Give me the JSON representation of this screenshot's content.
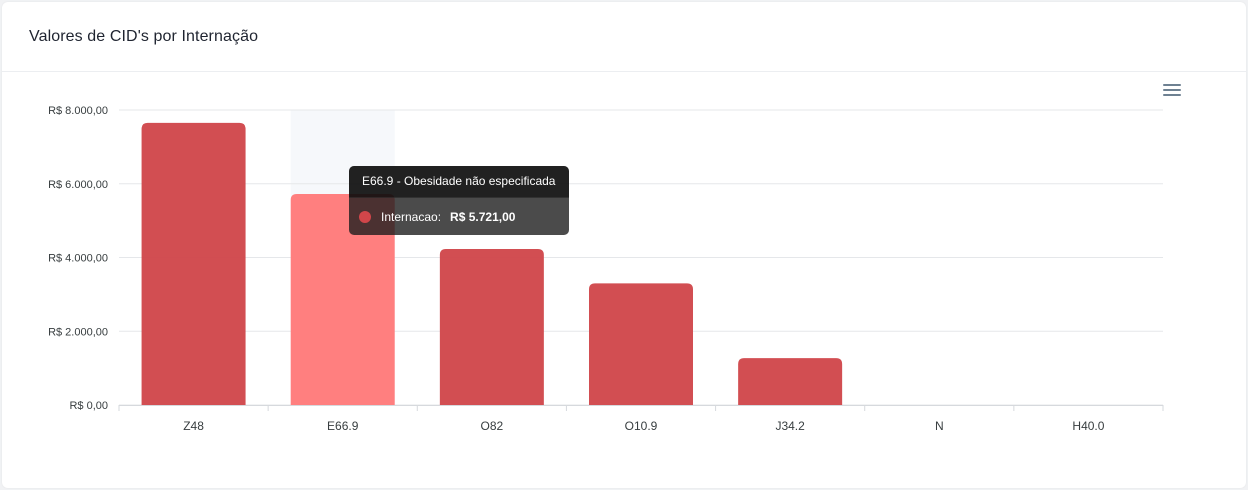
{
  "card": {
    "title": "Valores de CID's por Internação"
  },
  "toolbar": {
    "menu_icon": "hamburger-menu-icon"
  },
  "colors": {
    "bar": "#d0474b",
    "bar_hover": "#ff7f7f",
    "hover_band": "#f6f8fb",
    "grid": "#e5e7ea"
  },
  "chart_data": {
    "type": "bar",
    "title": "",
    "xlabel": "",
    "ylabel": "",
    "categories": [
      "Z48",
      "E66.9",
      "O82",
      "O10.9",
      "J34.2",
      "N",
      "H40.0"
    ],
    "series": [
      {
        "name": "Internacao",
        "values": [
          7650,
          5721,
          4230,
          3300,
          1270,
          0,
          0
        ]
      }
    ],
    "ylim": [
      0,
      8000
    ],
    "yticks": [
      "R$ 0,00",
      "R$ 2.000,00",
      "R$ 4.000,00",
      "R$ 6.000,00",
      "R$ 8.000,00"
    ],
    "grid": true,
    "highlighted_category": "E66.9"
  },
  "tooltip": {
    "title": "E66.9 - Obesidade não especificada",
    "series_label": "Internacao:",
    "value": "R$ 5.721,00"
  }
}
